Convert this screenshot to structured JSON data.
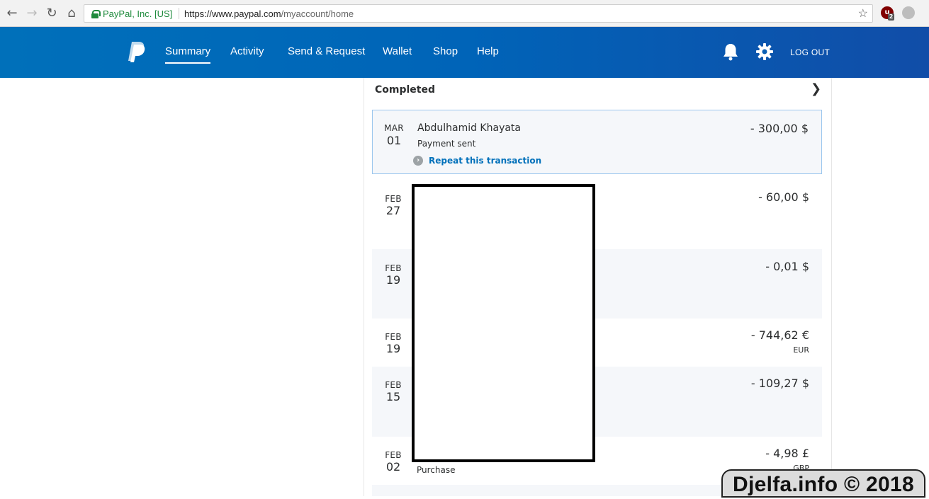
{
  "browser": {
    "site_identity": "PayPal, Inc. [US]",
    "url_host": "https://www.paypal.com",
    "url_path": "/myaccount/home",
    "ublock_badge": "2"
  },
  "header": {
    "nav": [
      "Summary",
      "Activity",
      "Send & Request",
      "Wallet",
      "Shop",
      "Help"
    ],
    "active_nav": "Summary",
    "logout": "LOG OUT",
    "brand_color": "#0070ba"
  },
  "activity": {
    "section_title": "Completed",
    "transactions": [
      {
        "month": "MAR",
        "day": "01",
        "name": "Abdulhamid Khayata",
        "type": "Payment sent",
        "amount": "- 300,00 $",
        "currency": "",
        "action": "Repeat this transaction"
      },
      {
        "month": "FEB",
        "day": "27",
        "name": "",
        "type": "",
        "amount": "- 60,00 $",
        "currency": ""
      },
      {
        "month": "FEB",
        "day": "19",
        "name": "",
        "type": "",
        "amount": "- 0,01 $",
        "currency": ""
      },
      {
        "month": "FEB",
        "day": "19",
        "name": "",
        "type": "",
        "amount": "- 744,62 €",
        "currency": "EUR"
      },
      {
        "month": "FEB",
        "day": "15",
        "name": "",
        "type": "",
        "amount": "- 109,27 $",
        "currency": ""
      },
      {
        "month": "FEB",
        "day": "02",
        "name": "",
        "type": "Purchase",
        "amount": "- 4,98 £",
        "currency": "GBP"
      }
    ]
  },
  "watermark": "Djelfa.info © 2018"
}
